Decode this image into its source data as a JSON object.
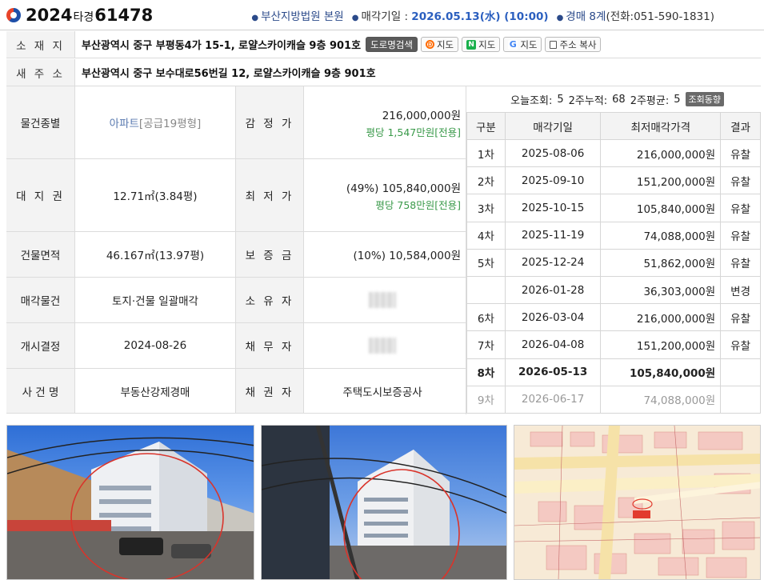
{
  "header": {
    "case_year": "2024",
    "case_type": "타경",
    "case_number": "61478",
    "court": "부산지방법원 본원",
    "sale_date_label": "매각기일 :",
    "sale_date": "2026.05.13(水) (10:00)",
    "dept": "경매 8계",
    "phone": "(전화:051-590-1831)"
  },
  "address": {
    "location_label": "소 재 지",
    "location": "부산광역시 중구 부평동4가 15-1, 로얄스카이캐슬 9층 901호",
    "road_search_btn": "도로명검색",
    "map_daum_btn": "지도",
    "map_naver_btn": "지도",
    "map_google_btn": "지도",
    "copy_btn": "주소 복사",
    "new_label": "새 주 소",
    "new_address": "부산광역시 중구 보수대로56번길 12, 로얄스카이캐슬 9층 901호"
  },
  "info": {
    "type_label": "물건종별",
    "type_value": "아파트",
    "type_sub": "[공급19평형]",
    "appraisal_label": "감 정 가",
    "appraisal_value": "216,000,000원",
    "appraisal_per": "평당 1,547만원[전용]",
    "land_label": "대 지 권",
    "land_value": "12.71㎡(3.84평)",
    "min_label": "최 저 가",
    "min_value": "(49%) 105,840,000원",
    "min_per": "평당 758만원[전용]",
    "bldg_label": "건물면적",
    "bldg_value": "46.167㎡(13.97평)",
    "deposit_label": "보 증 금",
    "deposit_value": "(10%) 10,584,000원",
    "sale_obj_label": "매각물건",
    "sale_obj_value": "토지·건물 일괄매각",
    "owner_label": "소 유 자",
    "start_label": "개시결정",
    "start_value": "2024-08-26",
    "debtor_label": "채 무 자",
    "case_label": "사 건 명",
    "case_value": "부동산강제경매",
    "creditor_label": "채 권 자",
    "creditor_value": "주택도시보증공사"
  },
  "stats": {
    "today_label": "오늘조회:",
    "today": "5",
    "two_week_label": "2주누적:",
    "two_week": "68",
    "avg_label": "2주평균:",
    "avg": "5",
    "trend_btn": "조회동향"
  },
  "schedule": {
    "headers": [
      "구분",
      "매각기일",
      "최저매각가격",
      "결과"
    ],
    "rows": [
      {
        "round": "1차",
        "date": "2025-08-06",
        "price": "216,000,000원",
        "result": "유찰"
      },
      {
        "round": "2차",
        "date": "2025-09-10",
        "price": "151,200,000원",
        "result": "유찰"
      },
      {
        "round": "3차",
        "date": "2025-10-15",
        "price": "105,840,000원",
        "result": "유찰"
      },
      {
        "round": "4차",
        "date": "2025-11-19",
        "price": "74,088,000원",
        "result": "유찰"
      },
      {
        "round": "5차",
        "date": "2025-12-24",
        "price": "51,862,000원",
        "result": "유찰"
      },
      {
        "round": "",
        "date": "2026-01-28",
        "price": "36,303,000원",
        "result": "변경"
      },
      {
        "round": "6차",
        "date": "2026-03-04",
        "price": "216,000,000원",
        "result": "유찰"
      },
      {
        "round": "7차",
        "date": "2026-04-08",
        "price": "151,200,000원",
        "result": "유찰"
      },
      {
        "round": "8차",
        "date": "2026-05-13",
        "price": "105,840,000원",
        "result": ""
      },
      {
        "round": "9차",
        "date": "2026-06-17",
        "price": "74,088,000원",
        "result": ""
      }
    ]
  }
}
